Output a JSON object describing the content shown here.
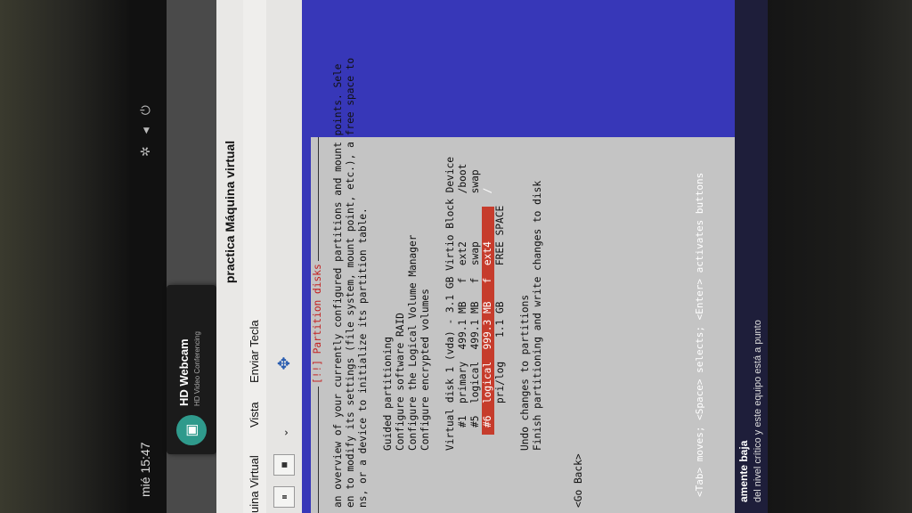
{
  "host": {
    "clock": "mié 15:47",
    "webcam_title": "HD Webcam",
    "webcam_subtitle": "HD Video Conferencing"
  },
  "vm": {
    "title": "practica Máquina virtual",
    "menu": [
      "uina Virtual",
      "Vista",
      "Enviar Tecla"
    ]
  },
  "installer": {
    "title": "[!!] Partition disks",
    "intro": [
      "an overview of your currently configured partitions and mount points. Sele",
      "en to modify its settings (file system, mount point, etc.), a free space to",
      "ns, or a device to initialize its partition table."
    ],
    "actions": [
      "Guided partitioning",
      "Configure software RAID",
      "Configure the Logical Volume Manager",
      "Configure encrypted volumes"
    ],
    "disk_header": "Virtual disk 1 (vda) - 3.1 GB Virtio Block Device",
    "partitions": [
      "#1  primary  499.1 MB   f  ext2        /boot",
      "#5  logical  499.1 MB   f  swap        swap",
      "#6  logical  999.3 MB   f  ext4        /",
      "    pri/log    1.1 GB      FREE SPACE"
    ],
    "selected_index": 2,
    "finish": [
      "Undo changes to partitions",
      "Finish partitioning and write changes to disk"
    ],
    "back": "<Go Back>"
  },
  "footer": {
    "hint": "<Tab> moves; <Space> selects; <Enter> activates buttons",
    "notification_title": "amente baja",
    "notification_body": "del nivel crítico y este equipo está a punto"
  },
  "colors": {
    "guest_bg": "#3737b8",
    "dialog_bg": "#c4c4c4",
    "selected_bg": "#c63c2c"
  }
}
